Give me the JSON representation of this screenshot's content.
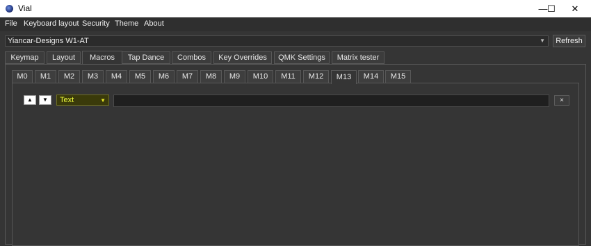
{
  "window": {
    "title": "Vial",
    "controls": {
      "minimize": "—",
      "maximize": "☐",
      "close": "✕"
    },
    "icon": "vial-app-icon"
  },
  "menu": [
    "File",
    "Keyboard layout",
    "Security",
    "Theme",
    "About"
  ],
  "device": {
    "selected": "Yiancar-Designs W1-AT",
    "refresh_label": "Refresh"
  },
  "tabs": {
    "items": [
      "Keymap",
      "Layout",
      "Macros",
      "Tap Dance",
      "Combos",
      "Key Overrides",
      "QMK Settings",
      "Matrix tester"
    ],
    "active": "Macros"
  },
  "macro_tabs": {
    "items": [
      "M0",
      "M1",
      "M2",
      "M3",
      "M4",
      "M5",
      "M6",
      "M7",
      "M8",
      "M9",
      "M10",
      "M11",
      "M12",
      "M13",
      "M14",
      "M15"
    ],
    "active": "M13"
  },
  "action_row": {
    "up_glyph": "▲",
    "down_glyph": "▼",
    "type_value": "Text",
    "text_value": "",
    "delete_glyph": "×"
  },
  "colors": {
    "background": "#353535",
    "highlight_text": "#f0ff3c",
    "highlight_bg": "#3a3a0a"
  }
}
